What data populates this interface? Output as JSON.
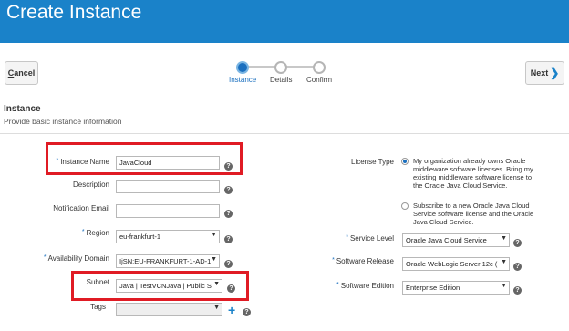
{
  "header": {
    "title": "Create Instance"
  },
  "toolbar": {
    "cancel_label": "Cancel",
    "cancel_underline": "C",
    "cancel_rest": "ancel",
    "next_label": "Next",
    "next_underline": "x"
  },
  "train": {
    "steps": [
      {
        "label": "Instance",
        "active": true
      },
      {
        "label": "Details",
        "active": false
      },
      {
        "label": "Confirm",
        "active": false
      }
    ]
  },
  "section": {
    "title": "Instance",
    "subtitle": "Provide basic instance information"
  },
  "form": {
    "instance_name": {
      "label": "Instance Name",
      "required": true,
      "value": "JavaCloud"
    },
    "description": {
      "label": "Description",
      "value": ""
    },
    "notification_email": {
      "label": "Notification Email",
      "value": ""
    },
    "region": {
      "label": "Region",
      "required": true,
      "value": "eu-frankfurt-1"
    },
    "availability_domain": {
      "label": "Availability Domain",
      "required": true,
      "value": "IjSN:EU-FRANKFURT-1-AD-1"
    },
    "subnet": {
      "label": "Subnet",
      "value": "Java | TestVCNJava | Public S"
    },
    "tags": {
      "label": "Tags",
      "value": ""
    },
    "license_type": {
      "label": "License Type",
      "options": [
        {
          "text": "My organization already owns Oracle middleware software licenses. Bring my existing middleware software license to the Oracle Java Cloud Service.",
          "checked": true
        },
        {
          "text": "Subscribe to a new Oracle Java Cloud Service software license and the Oracle Java Cloud Service.",
          "checked": false
        }
      ]
    },
    "service_level": {
      "label": "Service Level",
      "required": true,
      "value": "Oracle Java Cloud Service"
    },
    "software_release": {
      "label": "Software Release",
      "required": true,
      "value": "Oracle WebLogic Server 12c ("
    },
    "software_edition": {
      "label": "Software Edition",
      "required": true,
      "value": "Enterprise Edition"
    }
  },
  "colors": {
    "header_bg": "#1a82c9",
    "highlight": "#e01b24",
    "accent": "#1a6fbf"
  },
  "icons": {
    "help": "help-icon",
    "caret": "chevron-down-icon",
    "add": "plus-icon",
    "next": "chevron-right-icon"
  }
}
